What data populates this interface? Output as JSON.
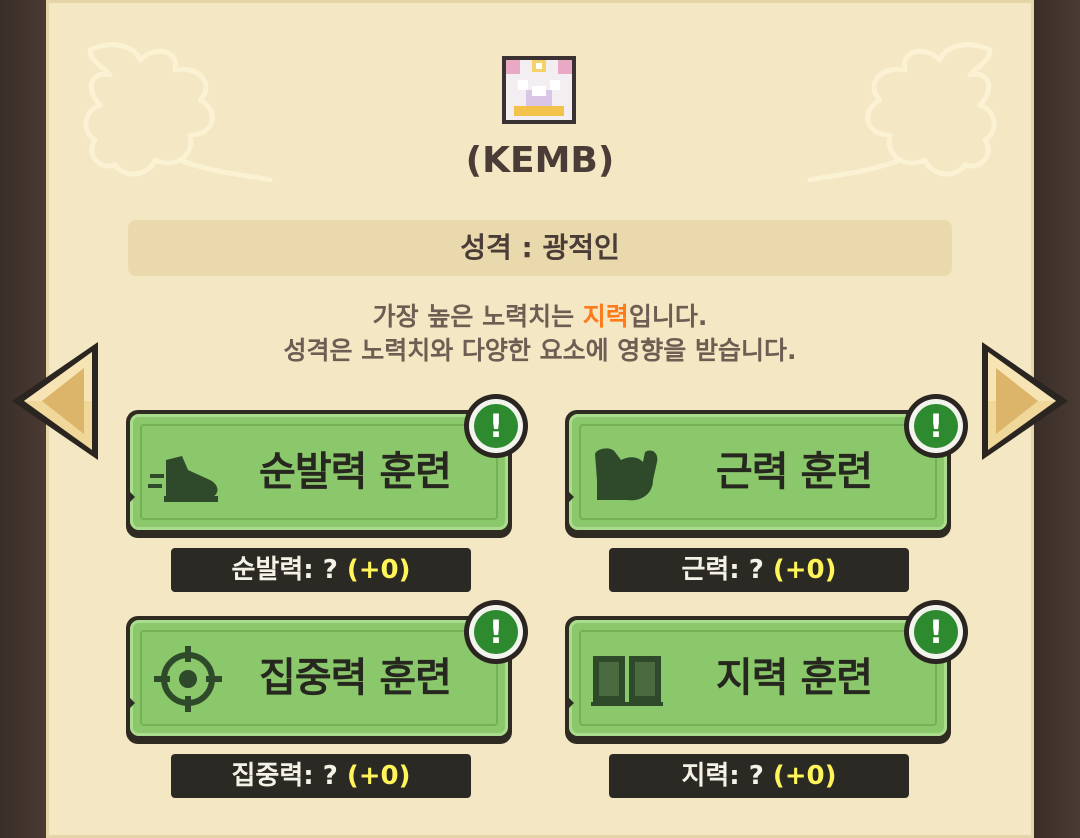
{
  "pet": {
    "name": "(KEMB)",
    "personality": "성격 : 광적인",
    "desc_line1_pre": "가장 높은 노력치는 ",
    "desc_line1_highlight": "지력",
    "desc_line1_post": "입니다.",
    "desc_line2": "성격은 노력치와 다양한 요소에 영향을 받습니다."
  },
  "trainings": [
    {
      "label": "순발력 훈련",
      "icon": "shoe-icon",
      "stat_label": "순발력: ? ",
      "stat_gain": "(+0)",
      "alert": "!"
    },
    {
      "label": "근력 훈련",
      "icon": "muscle-arm-icon",
      "stat_label": "근력: ? ",
      "stat_gain": "(+0)",
      "alert": "!"
    },
    {
      "label": "집중력 훈련",
      "icon": "crosshair-icon",
      "stat_label": "집중력: ? ",
      "stat_gain": "(+0)",
      "alert": "!"
    },
    {
      "label": "지력 훈련",
      "icon": "book-icon",
      "stat_label": "지력: ? ",
      "stat_gain": "(+0)",
      "alert": "!"
    }
  ],
  "nav": {
    "prev": "arrow-left-icon",
    "next": "arrow-right-icon"
  },
  "colors": {
    "panel": "#f3e7c4",
    "button_green": "#8bc76b",
    "alert_green": "#2d8a2e",
    "highlight_orange": "#ff7a1a",
    "gain_yellow": "#fff45a"
  }
}
